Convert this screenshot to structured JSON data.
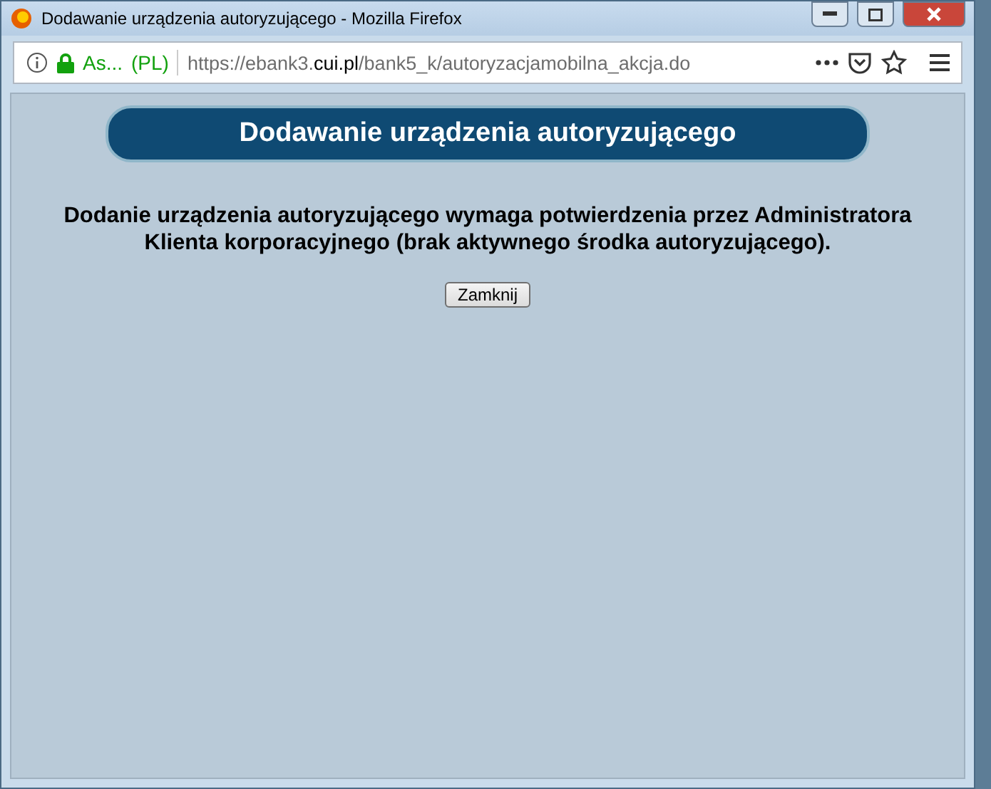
{
  "window": {
    "title": "Dodawanie urządzenia autoryzującego - Mozilla Firefox"
  },
  "address_bar": {
    "identity": "As...",
    "country": "(PL)",
    "url_prefix": "https://ebank3.",
    "url_domain": "cui.pl",
    "url_path": "/bank5_k/autoryzacjamobilna_akcja.do"
  },
  "page": {
    "heading": "Dodawanie urządzenia autoryzującego",
    "message": "Dodanie urządzenia autoryzującego wymaga potwierdzenia przez Administratora Klienta korporacyjnego (brak aktywnego środka autoryzującego).",
    "buttons": [
      "Zamknij"
    ]
  }
}
